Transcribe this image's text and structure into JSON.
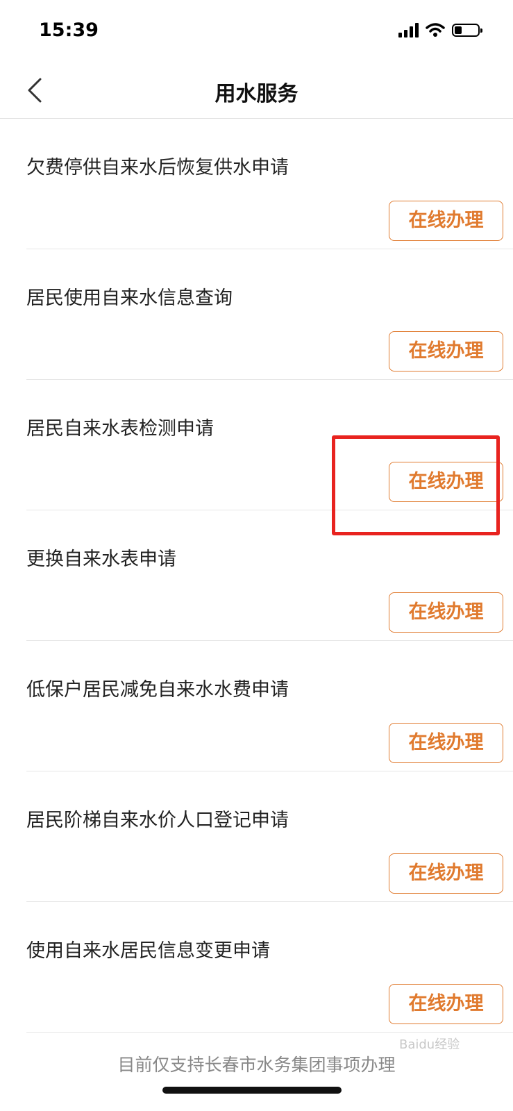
{
  "status_bar": {
    "time": "15:39"
  },
  "nav": {
    "title": "用水服务"
  },
  "services": [
    {
      "title": "欠费停供自来水后恢复供水申请",
      "action": "在线办理"
    },
    {
      "title": "居民使用自来水信息查询",
      "action": "在线办理"
    },
    {
      "title": "居民自来水表检测申请",
      "action": "在线办理"
    },
    {
      "title": "更换自来水表申请",
      "action": "在线办理"
    },
    {
      "title": "低保户居民减免自来水水费申请",
      "action": "在线办理"
    },
    {
      "title": "居民阶梯自来水价人口登记申请",
      "action": "在线办理"
    },
    {
      "title": "使用自来水居民信息变更申请",
      "action": "在线办理"
    }
  ],
  "footer": {
    "note": "目前仅支持长春市水务集团事项办理"
  },
  "watermark": {
    "text": "Baidu经验"
  },
  "colors": {
    "accent": "#e07a2e",
    "highlight": "#e8231f"
  }
}
